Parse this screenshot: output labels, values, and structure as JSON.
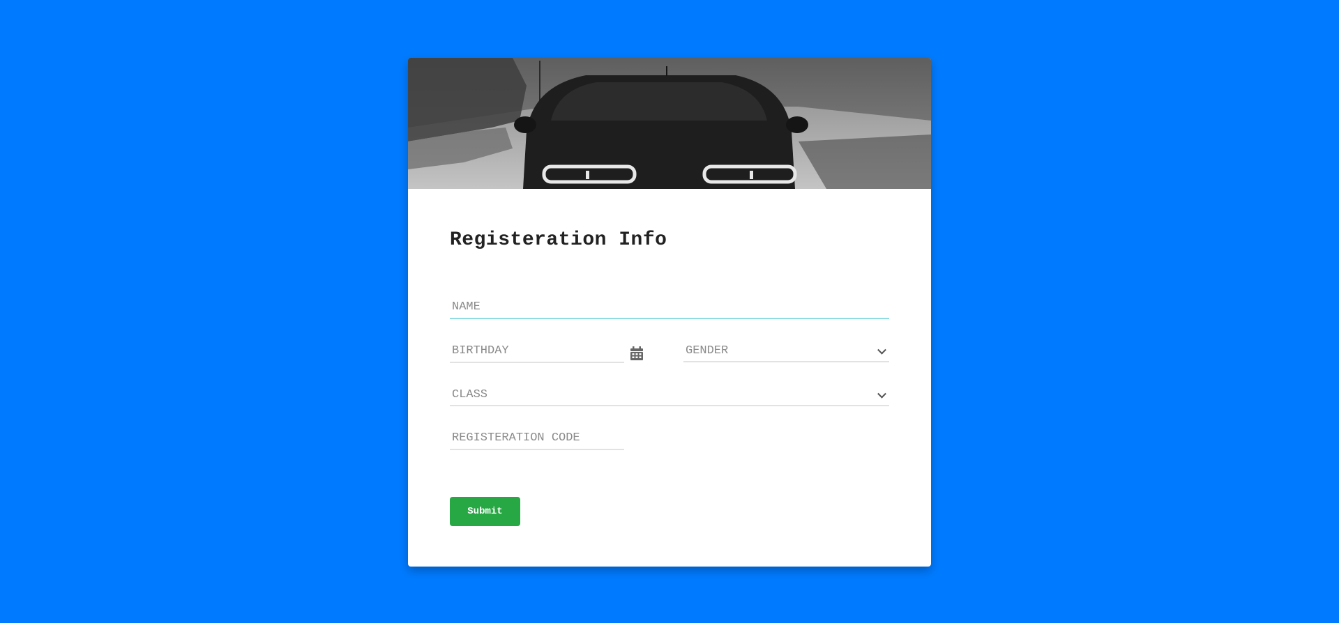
{
  "form": {
    "title": "Registeration Info",
    "name_placeholder": "NAME",
    "birthday_placeholder": "BIRTHDAY",
    "gender_label": "GENDER",
    "class_label": "CLASS",
    "registration_code_placeholder": "REGISTERATION CODE",
    "submit_label": "Submit"
  },
  "colors": {
    "background": "#007bff",
    "submit": "#28a745",
    "active_underline": "#8fdde3"
  },
  "icons": {
    "birthday": "calendar-icon",
    "gender": "chevron-down-icon",
    "class": "chevron-down-icon"
  }
}
